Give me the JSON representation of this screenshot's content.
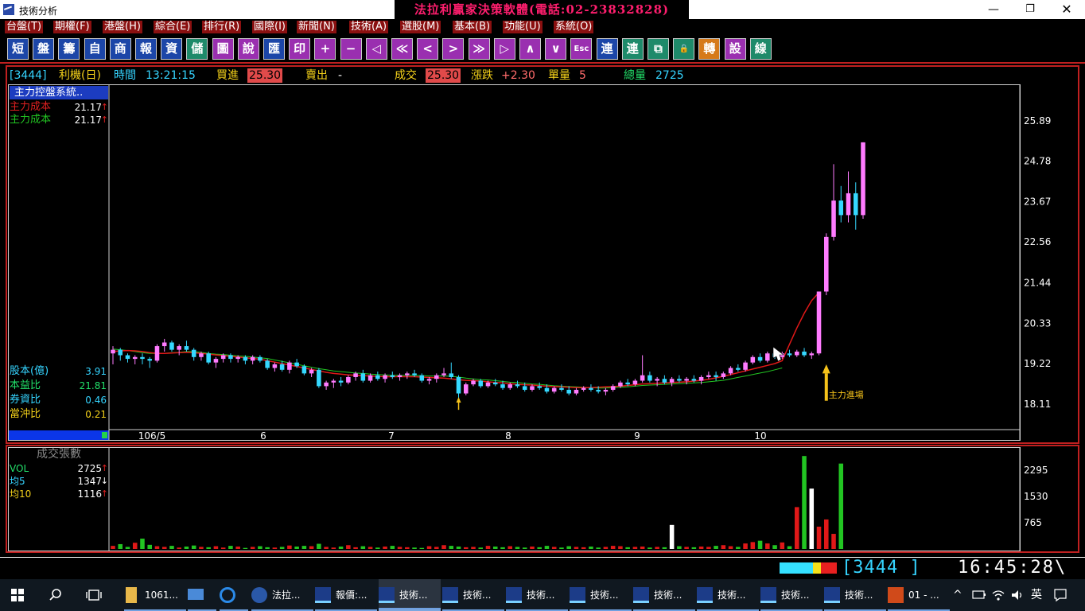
{
  "window": {
    "title": "技術分析",
    "banner": "法拉利贏家決策軟體(電話:02-23832828)",
    "min": "—",
    "max": "❐",
    "close": "✕"
  },
  "menu": [
    "台盤(T)",
    "期權(F)",
    "港盤(H)",
    "綜合(E)",
    "排行(R)",
    "國際(I)",
    "新聞(N)",
    "技術(A)",
    "選股(M)",
    "基本(B)",
    "功能(U)",
    "系統(O)"
  ],
  "toolbar": [
    {
      "label": "短",
      "color": "blue"
    },
    {
      "label": "盤",
      "color": "blue"
    },
    {
      "label": "籌",
      "color": "blue"
    },
    {
      "label": "自",
      "color": "blue"
    },
    {
      "label": "商",
      "color": "blue"
    },
    {
      "label": "報",
      "color": "blue"
    },
    {
      "label": "資",
      "color": "blue"
    },
    {
      "label": "儲",
      "color": "teal"
    },
    {
      "label": "圖",
      "color": "purple"
    },
    {
      "label": "說",
      "color": "purple"
    },
    {
      "label": "匯",
      "color": "blue"
    },
    {
      "label": "印",
      "color": "purple"
    },
    {
      "label": "+",
      "color": "purple"
    },
    {
      "label": "−",
      "color": "purple"
    },
    {
      "label": "◁",
      "color": "purple"
    },
    {
      "label": "≪",
      "color": "purple"
    },
    {
      "label": "<",
      "color": "purple"
    },
    {
      "label": ">",
      "color": "purple"
    },
    {
      "label": "≫",
      "color": "purple"
    },
    {
      "label": "▷",
      "color": "purple"
    },
    {
      "label": "∧",
      "color": "purple"
    },
    {
      "label": "∨",
      "color": "purple"
    },
    {
      "label": "Esc",
      "color": "purple"
    },
    {
      "label": "連",
      "color": "blue"
    },
    {
      "label": "連",
      "color": "teal"
    },
    {
      "label": "⧉",
      "color": "teal"
    },
    {
      "label": "🔒",
      "color": "teal"
    },
    {
      "label": "轉",
      "color": "orange"
    },
    {
      "label": "設",
      "color": "purple"
    },
    {
      "label": "線",
      "color": "teal"
    }
  ],
  "quote": {
    "code": "[3444]",
    "name": "利機(日)",
    "time_label": "時間",
    "time": "13:21:15",
    "bid_label": "買進",
    "bid": "25.30",
    "ask_label": "賣出",
    "ask": "-",
    "last_label": "成交",
    "last": "25.30",
    "change_label": "漲跌",
    "change": "+2.30",
    "vol_label": "單量",
    "vol": "5",
    "total_label": "總量",
    "total": "2725"
  },
  "left_panel": {
    "title": "主力控盤系統..",
    "cost1": {
      "label": "主力成本",
      "value": "21.17",
      "arrow": "↑"
    },
    "cost2": {
      "label": "主力成本",
      "value": "21.17",
      "arrow": "↑"
    },
    "stats": [
      {
        "label": "股本(億)",
        "value": "3.91"
      },
      {
        "label": "本益比",
        "value": "21.81"
      },
      {
        "label": "券資比",
        "value": "0.46"
      },
      {
        "label": "當沖比",
        "value": "0.21"
      }
    ]
  },
  "vol_panel": {
    "title": "成交張數",
    "rows": [
      {
        "label": "VOL",
        "value": "2725",
        "arrow": "↑"
      },
      {
        "label": "均5",
        "value": "1347",
        "arrow": "↓"
      },
      {
        "label": "均10",
        "value": "1116",
        "arrow": "↑"
      }
    ]
  },
  "chart_data": {
    "type": "candlestick",
    "price_axis": {
      "ticks": [
        25.89,
        24.78,
        23.67,
        22.56,
        21.44,
        20.33,
        19.22,
        18.11
      ],
      "ylim": [
        17.45,
        26.85
      ]
    },
    "x_labels": [
      "106/5",
      "6",
      "7",
      "8",
      "9",
      "10"
    ],
    "annotation": "主力進場",
    "volume_axis": {
      "ticks": [
        2295,
        1530,
        765
      ],
      "ylim": [
        0,
        2900
      ]
    },
    "colors": {
      "up": "#ff7bff",
      "down": "#35d8ff",
      "ma_green": "#22c522",
      "ma_red": "#e01818",
      "vol_up": "#e01818",
      "vol_down": "#22c522",
      "vol_flat": "#ffffff"
    },
    "candles": [
      [
        19.5,
        19.7,
        19.2,
        19.6
      ],
      [
        19.6,
        19.65,
        19.3,
        19.45
      ],
      [
        19.45,
        19.5,
        19.25,
        19.35
      ],
      [
        19.35,
        19.45,
        19.2,
        19.4
      ],
      [
        19.4,
        19.5,
        19.2,
        19.35
      ],
      [
        19.35,
        19.4,
        19.1,
        19.3
      ],
      [
        19.3,
        19.75,
        19.25,
        19.7
      ],
      [
        19.7,
        19.9,
        19.55,
        19.8
      ],
      [
        19.8,
        19.85,
        19.55,
        19.6
      ],
      [
        19.6,
        19.75,
        19.45,
        19.7
      ],
      [
        19.7,
        19.85,
        19.55,
        19.6
      ],
      [
        19.6,
        19.65,
        19.3,
        19.4
      ],
      [
        19.4,
        19.55,
        19.3,
        19.5
      ],
      [
        19.5,
        19.55,
        19.2,
        19.25
      ],
      [
        19.25,
        19.4,
        19.1,
        19.35
      ],
      [
        19.35,
        19.5,
        19.25,
        19.45
      ],
      [
        19.45,
        19.5,
        19.25,
        19.35
      ],
      [
        19.35,
        19.45,
        19.25,
        19.4
      ],
      [
        19.4,
        19.45,
        19.2,
        19.3
      ],
      [
        19.3,
        19.45,
        19.2,
        19.4
      ],
      [
        19.4,
        19.45,
        19.25,
        19.3
      ],
      [
        19.3,
        19.35,
        19.05,
        19.1
      ],
      [
        19.1,
        19.25,
        19.0,
        19.2
      ],
      [
        19.2,
        19.3,
        19.0,
        19.05
      ],
      [
        19.05,
        19.3,
        18.95,
        19.25
      ],
      [
        19.25,
        19.35,
        19.1,
        19.15
      ],
      [
        19.15,
        19.2,
        18.9,
        18.95
      ],
      [
        18.95,
        19.1,
        18.85,
        19.05
      ],
      [
        19.05,
        19.1,
        18.55,
        18.6
      ],
      [
        18.6,
        18.75,
        18.5,
        18.7
      ],
      [
        18.7,
        18.8,
        18.55,
        18.75
      ],
      [
        18.75,
        18.85,
        18.6,
        18.7
      ],
      [
        18.7,
        18.9,
        18.65,
        18.85
      ],
      [
        18.85,
        19.0,
        18.75,
        18.95
      ],
      [
        18.95,
        19.05,
        18.7,
        18.75
      ],
      [
        18.75,
        18.95,
        18.7,
        18.9
      ],
      [
        18.9,
        19.0,
        18.75,
        18.8
      ],
      [
        18.8,
        18.95,
        18.7,
        18.9
      ],
      [
        18.9,
        19.0,
        18.8,
        18.85
      ],
      [
        18.85,
        18.95,
        18.75,
        18.9
      ],
      [
        18.9,
        19.0,
        18.8,
        18.95
      ],
      [
        18.95,
        19.05,
        18.85,
        18.9
      ],
      [
        18.9,
        18.95,
        18.7,
        18.75
      ],
      [
        18.75,
        18.85,
        18.65,
        18.8
      ],
      [
        18.8,
        18.95,
        18.7,
        18.9
      ],
      [
        18.9,
        19.1,
        18.85,
        18.95
      ],
      [
        18.95,
        19.25,
        18.8,
        18.85
      ],
      [
        18.85,
        18.9,
        18.25,
        18.4
      ],
      [
        18.4,
        18.7,
        18.35,
        18.65
      ],
      [
        18.65,
        18.8,
        18.6,
        18.75
      ],
      [
        18.75,
        18.8,
        18.55,
        18.6
      ],
      [
        18.6,
        18.75,
        18.55,
        18.7
      ],
      [
        18.7,
        18.8,
        18.6,
        18.65
      ],
      [
        18.65,
        18.75,
        18.5,
        18.55
      ],
      [
        18.55,
        18.7,
        18.5,
        18.65
      ],
      [
        18.65,
        18.75,
        18.55,
        18.6
      ],
      [
        18.6,
        18.7,
        18.45,
        18.5
      ],
      [
        18.5,
        18.65,
        18.45,
        18.6
      ],
      [
        18.6,
        18.7,
        18.5,
        18.55
      ],
      [
        18.55,
        18.65,
        18.4,
        18.45
      ],
      [
        18.45,
        18.6,
        18.4,
        18.55
      ],
      [
        18.55,
        18.65,
        18.45,
        18.5
      ],
      [
        18.5,
        18.6,
        18.35,
        18.4
      ],
      [
        18.4,
        18.55,
        18.35,
        18.5
      ],
      [
        18.5,
        18.6,
        18.45,
        18.55
      ],
      [
        18.55,
        18.65,
        18.45,
        18.5
      ],
      [
        18.5,
        18.6,
        18.4,
        18.45
      ],
      [
        18.45,
        18.55,
        18.35,
        18.5
      ],
      [
        18.5,
        18.65,
        18.45,
        18.6
      ],
      [
        18.6,
        18.75,
        18.55,
        18.7
      ],
      [
        18.7,
        18.8,
        18.6,
        18.65
      ],
      [
        18.65,
        18.8,
        18.6,
        18.75
      ],
      [
        18.75,
        19.45,
        18.7,
        18.9
      ],
      [
        18.9,
        19.0,
        18.7,
        18.75
      ],
      [
        18.75,
        18.85,
        18.6,
        18.8
      ],
      [
        18.8,
        18.9,
        18.65,
        18.7
      ],
      [
        18.7,
        18.85,
        18.6,
        18.8
      ],
      [
        18.8,
        18.9,
        18.7,
        18.75
      ],
      [
        18.75,
        18.85,
        18.65,
        18.8
      ],
      [
        18.8,
        18.9,
        18.7,
        18.75
      ],
      [
        18.75,
        18.9,
        18.65,
        18.85
      ],
      [
        18.85,
        19.0,
        18.8,
        18.9
      ],
      [
        18.9,
        19.0,
        18.75,
        18.85
      ],
      [
        18.85,
        19.0,
        18.8,
        18.95
      ],
      [
        18.95,
        19.15,
        18.9,
        19.1
      ],
      [
        19.1,
        19.2,
        19.0,
        19.05
      ],
      [
        19.05,
        19.3,
        19.0,
        19.25
      ],
      [
        19.25,
        19.45,
        19.2,
        19.4
      ],
      [
        19.4,
        19.5,
        19.25,
        19.3
      ],
      [
        19.3,
        19.55,
        19.25,
        19.5
      ],
      [
        19.5,
        19.6,
        19.35,
        19.4
      ],
      [
        19.4,
        19.55,
        19.35,
        19.5
      ],
      [
        19.5,
        19.6,
        19.4,
        19.45
      ],
      [
        19.45,
        19.6,
        19.4,
        19.55
      ],
      [
        19.55,
        19.65,
        19.4,
        19.45
      ],
      [
        19.45,
        19.55,
        19.35,
        19.5
      ],
      [
        19.5,
        21.2,
        19.45,
        21.2
      ],
      [
        21.2,
        22.8,
        21.1,
        22.7
      ],
      [
        22.7,
        24.7,
        22.6,
        23.7
      ],
      [
        23.7,
        24.1,
        23.1,
        23.3
      ],
      [
        23.3,
        24.5,
        23.1,
        23.9
      ],
      [
        23.9,
        24.2,
        22.9,
        23.3
      ],
      [
        23.3,
        25.3,
        23.2,
        25.3
      ]
    ],
    "ma_green": [
      19.62,
      19.6,
      19.58,
      19.55,
      19.52,
      19.5,
      19.5,
      19.5,
      19.52,
      19.53,
      19.55,
      19.55,
      19.53,
      19.5,
      19.48,
      19.47,
      19.45,
      19.43,
      19.42,
      19.4,
      19.38,
      19.36,
      19.32,
      19.28,
      19.24,
      19.2,
      19.16,
      19.12,
      19.08,
      19.05,
      19.02,
      19.0,
      18.98,
      18.96,
      18.95,
      18.93,
      18.92,
      18.91,
      18.9,
      18.9,
      18.9,
      18.9,
      18.89,
      18.88,
      18.88,
      18.88,
      18.87,
      18.85,
      18.82,
      18.8,
      18.78,
      18.77,
      18.75,
      18.73,
      18.71,
      18.7,
      18.68,
      18.66,
      18.65,
      18.63,
      18.61,
      18.6,
      18.59,
      18.58,
      18.57,
      18.56,
      18.55,
      18.55,
      18.56,
      18.57,
      18.58,
      18.6,
      18.62,
      18.63,
      18.64,
      18.65,
      18.66,
      18.67,
      18.68,
      18.69,
      18.7,
      18.72,
      18.74,
      18.76,
      18.8,
      18.84,
      18.88,
      18.92,
      18.96,
      19.0,
      19.05,
      19.1
    ],
    "ma_red": [
      19.55,
      19.57,
      19.58,
      19.57,
      19.55,
      19.52,
      19.5,
      19.5,
      19.51,
      19.52,
      19.53,
      19.52,
      19.5,
      19.48,
      19.46,
      19.44,
      19.42,
      19.4,
      19.38,
      19.36,
      19.34,
      19.3,
      19.26,
      19.22,
      19.18,
      19.14,
      19.1,
      19.06,
      19.02,
      18.98,
      18.95,
      18.93,
      18.91,
      18.9,
      18.89,
      18.88,
      18.87,
      18.86,
      18.86,
      18.86,
      18.86,
      18.86,
      18.85,
      18.84,
      18.83,
      18.82,
      18.8,
      18.78,
      18.76,
      18.75,
      18.74,
      18.72,
      18.7,
      18.69,
      18.67,
      18.65,
      18.64,
      18.63,
      18.61,
      18.6,
      18.59,
      18.58,
      18.57,
      18.56,
      18.56,
      18.56,
      18.57,
      18.58,
      18.59,
      18.6,
      18.62,
      18.64,
      18.66,
      18.67,
      18.68,
      18.69,
      18.7,
      18.71,
      18.72,
      18.74,
      18.76,
      18.79,
      18.83,
      18.87,
      18.92,
      18.97,
      19.02,
      19.07,
      19.12,
      19.17,
      19.22,
      19.3,
      19.75,
      20.2,
      20.6,
      20.95,
      21.17
    ],
    "volume": [
      90,
      140,
      60,
      180,
      300,
      120,
      80,
      60,
      90,
      40,
      70,
      100,
      60,
      50,
      80,
      40,
      90,
      70,
      30,
      60,
      80,
      50,
      40,
      60,
      100,
      70,
      90,
      80,
      150,
      60,
      40,
      70,
      110,
      50,
      80,
      60,
      40,
      70,
      90,
      60,
      50,
      40,
      30,
      80,
      60,
      110,
      90,
      70,
      50,
      60,
      40,
      90,
      70,
      50,
      80,
      60,
      40,
      70,
      50,
      90,
      60,
      40,
      80,
      60,
      50,
      70,
      40,
      60,
      90,
      80,
      50,
      60,
      70,
      40,
      60,
      50,
      700,
      80,
      60,
      50,
      70,
      60,
      90,
      110,
      80,
      60,
      160,
      200,
      240,
      160,
      110,
      190,
      80,
      1220,
      2710,
      1760,
      650,
      860,
      440,
      2490
    ]
  },
  "status": {
    "code": "[3444  ]",
    "time": "16:45:28\\"
  },
  "taskbar": {
    "items": [
      {
        "label": "1061...",
        "icon": "folder-icon"
      },
      {
        "label": "",
        "icon": "computer-icon"
      },
      {
        "label": "",
        "icon": "ie-icon"
      },
      {
        "label": "法拉...",
        "icon": "app-icon"
      },
      {
        "label": "報價:...",
        "icon": "chart-app-icon"
      },
      {
        "label": "技術...",
        "icon": "chart-app-icon"
      },
      {
        "label": "技術...",
        "icon": "chart-app-icon"
      },
      {
        "label": "技術...",
        "icon": "chart-app-icon"
      },
      {
        "label": "技術...",
        "icon": "chart-app-icon"
      },
      {
        "label": "技術...",
        "icon": "chart-app-icon"
      },
      {
        "label": "技術...",
        "icon": "chart-app-icon"
      },
      {
        "label": "技術...",
        "icon": "chart-app-icon"
      },
      {
        "label": "技術...",
        "icon": "chart-app-icon"
      },
      {
        "label": "01 - ...",
        "icon": "powerpoint-icon"
      }
    ],
    "ime": "英"
  }
}
